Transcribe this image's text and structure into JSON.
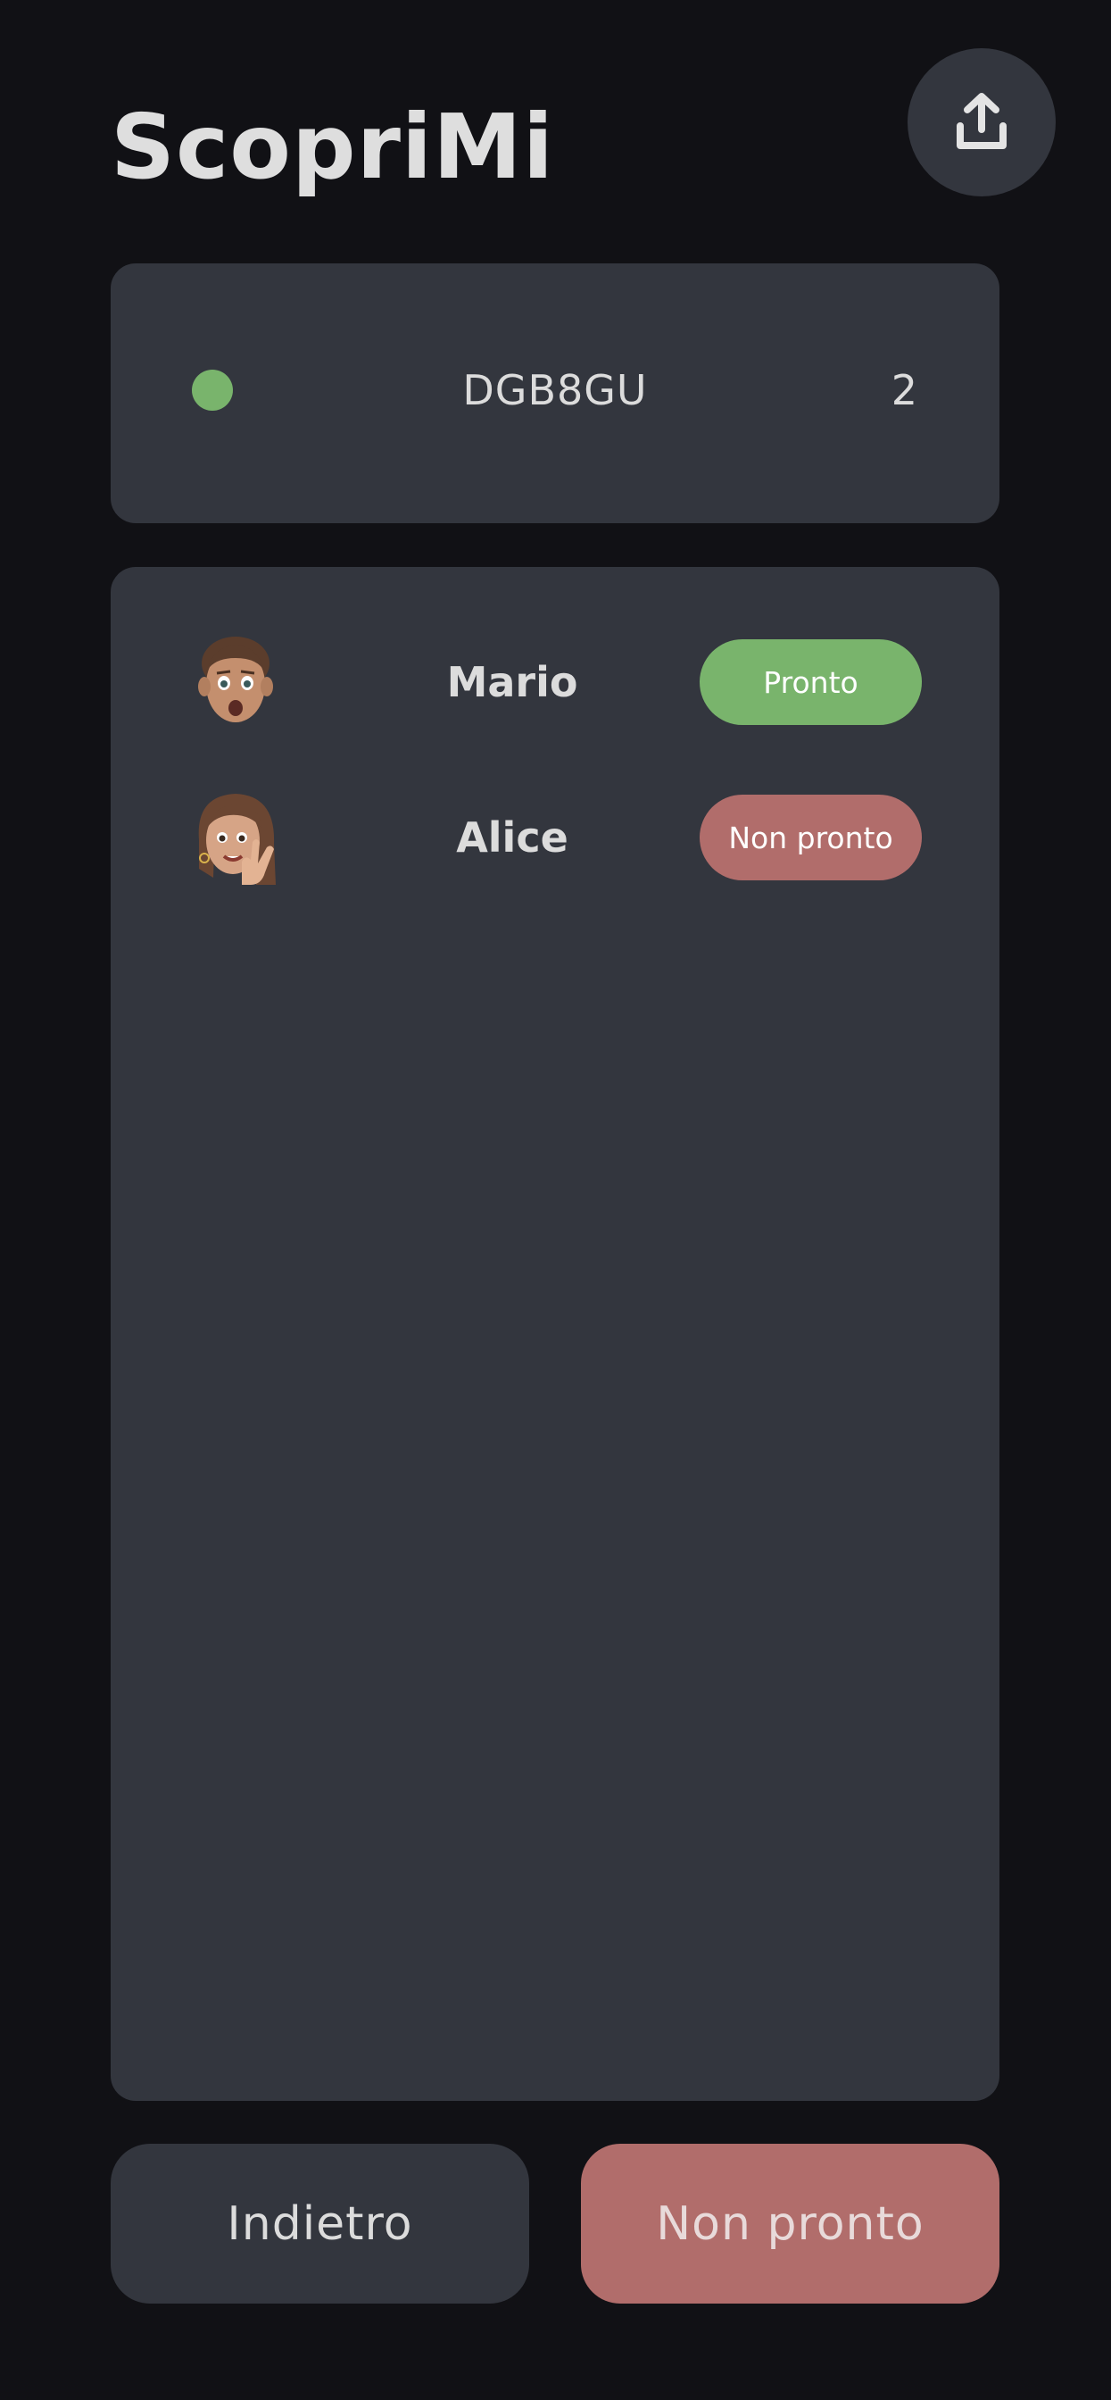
{
  "header": {
    "title": "ScopriMi",
    "share_icon": "share-upload-icon"
  },
  "room": {
    "status_color": "#79b46c",
    "code": "DGB8GU",
    "player_count": "2"
  },
  "players": [
    {
      "name": "Mario",
      "status": "Pronto",
      "status_color": "#79b46c",
      "avatar": "memoji-man-surprised"
    },
    {
      "name": "Alice",
      "status": "Non pronto",
      "status_color": "#b16d6b",
      "avatar": "memoji-woman-peace-sign"
    }
  ],
  "footer": {
    "back_label": "Indietro",
    "ready_label": "Non pronto",
    "ready_color": "#b16d6b"
  },
  "colors": {
    "background": "#111115",
    "card": "#33363e",
    "text": "#dcdcdc"
  }
}
